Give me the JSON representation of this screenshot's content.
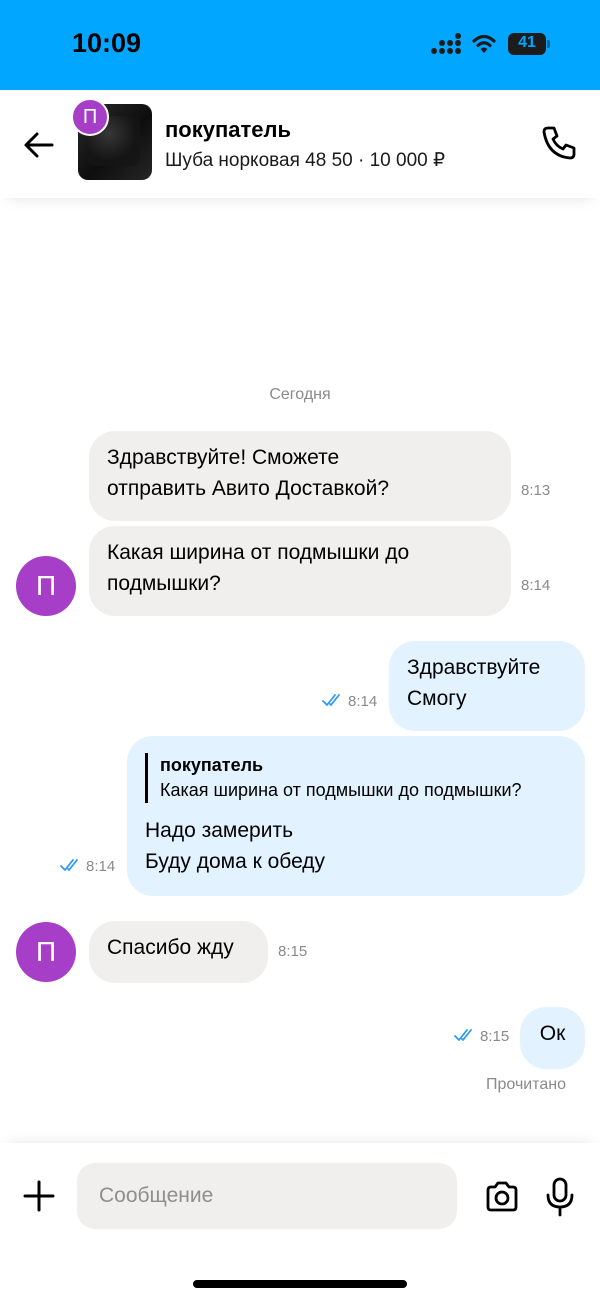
{
  "status_bar": {
    "time": "10:09",
    "battery": "41",
    "battery_level": 0.41,
    "background_color": "#00a6ff",
    "icons": [
      "signal-icon",
      "wifi-icon",
      "battery-icon"
    ]
  },
  "header": {
    "avatar_letter": "П",
    "name": "покупатель",
    "subtitle": "Шуба норковая 48 50 · 10 000 ₽",
    "icons": [
      "back-arrow-icon",
      "phone-icon"
    ]
  },
  "chat": {
    "date_label": "Сегодня",
    "avatar_letter": "П",
    "avatar_color": "#a63ec8",
    "messages": [
      {
        "direction": "incoming",
        "text": "Здравствуйте! Сможете\nотправить Авито Доставкой?",
        "time": "8:13"
      },
      {
        "direction": "incoming",
        "text": "Какая ширина от подмышки до\nподмышки?",
        "time": "8:14"
      },
      {
        "direction": "outgoing",
        "text": "Здравствуйте\nСмогу",
        "time": "8:14",
        "read": true
      },
      {
        "direction": "outgoing",
        "quote_author": "покупатель",
        "quote_text": "Какая ширина от подмышки до подмышки?",
        "text": "Надо замерить\nБуду дома к обеду",
        "time": "8:14",
        "read": true
      },
      {
        "direction": "incoming",
        "text": "Спасибо жду",
        "time": "8:15"
      },
      {
        "direction": "outgoing",
        "text": "Ок",
        "time": "8:15",
        "read": true
      }
    ],
    "read_status": "Прочитано",
    "check_color": "#2f9bf5"
  },
  "composer": {
    "placeholder": "Сообщение",
    "icons": [
      "plus-icon",
      "camera-icon",
      "microphone-icon"
    ]
  }
}
